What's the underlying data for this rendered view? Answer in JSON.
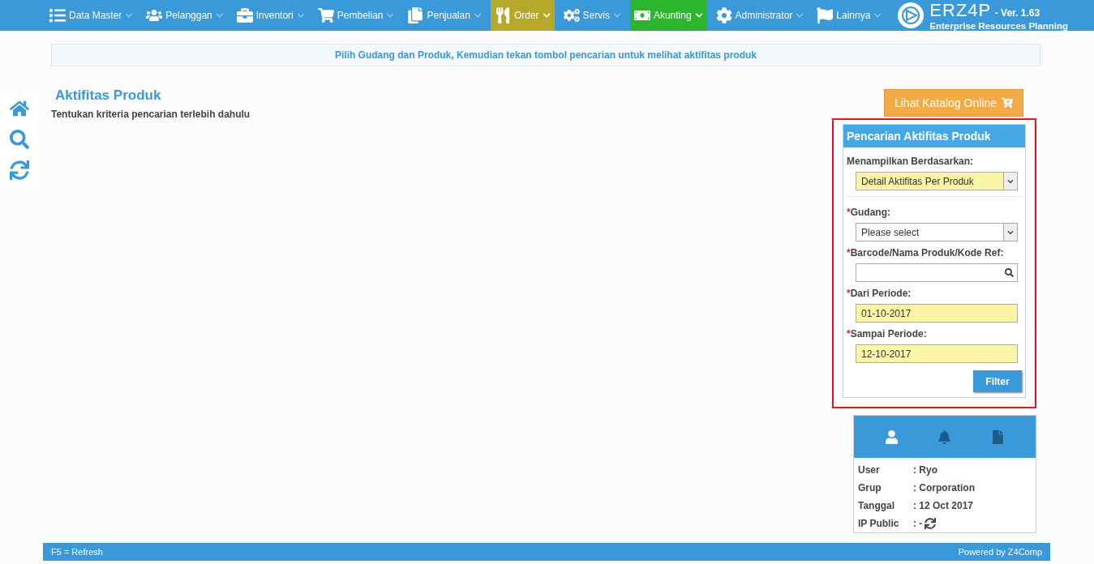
{
  "navbar": {
    "items": [
      {
        "label": "Data Master"
      },
      {
        "label": "Pelanggan"
      },
      {
        "label": "Inventori"
      },
      {
        "label": "Pembelian"
      },
      {
        "label": "Penjualan"
      },
      {
        "label": "Order",
        "color": "#b5a82a"
      },
      {
        "label": "Servis"
      },
      {
        "label": "Akunting",
        "color": "#2cb52f"
      },
      {
        "label": "Administrator"
      },
      {
        "label": "Lainnya"
      }
    ],
    "logo": {
      "name": "ERZ4P",
      "version": "- Ver. 1.63",
      "subtitle": "Enterprise Resources Planning"
    }
  },
  "info_bar": "Pilih Gudang dan Produk, Kemudian tekan tombol pencarian untuk melihat aktifitas produk",
  "page": {
    "title": "Aktifitas Produk",
    "subtitle": "Tentukan kriteria pencarian terlebih dahulu"
  },
  "catalog_button": "Lihat Katalog Online",
  "search_panel": {
    "title": "Pencarian Aktifitas Produk",
    "highlighted": true,
    "fields": [
      {
        "kind": "select",
        "label": "Menampilkan Berdasarkan:",
        "value": "Detail Aktifitas Per Produk",
        "filled": true,
        "divider": true
      },
      {
        "kind": "select",
        "mark": "*",
        "label": "Gudang:",
        "value": "Please select",
        "filled": false,
        "divider": false
      },
      {
        "kind": "search",
        "mark": "*",
        "label": "Barcode/Nama Produk/Kode Ref:",
        "filled": false,
        "divider": false
      },
      {
        "kind": "text",
        "mark": "*",
        "label": "Dari Periode:",
        "value": "01-10-2017",
        "filled": true,
        "divider": false
      },
      {
        "kind": "text",
        "mark": "*",
        "label": "Sampai Periode:",
        "value": "12-10-2017",
        "filled": true,
        "divider": false
      }
    ],
    "button": "Filter"
  },
  "user_panel": {
    "rows": [
      {
        "label": "User",
        "value": ": Ryo"
      },
      {
        "label": "Grup",
        "value": ": Corporation"
      },
      {
        "label": "Tanggal",
        "value": ": 12 Oct 2017"
      },
      {
        "label": "IP Public",
        "value": ": -"
      }
    ]
  },
  "footer": {
    "left": "F5 = Refresh",
    "right": "Powered by Z4Comp"
  }
}
